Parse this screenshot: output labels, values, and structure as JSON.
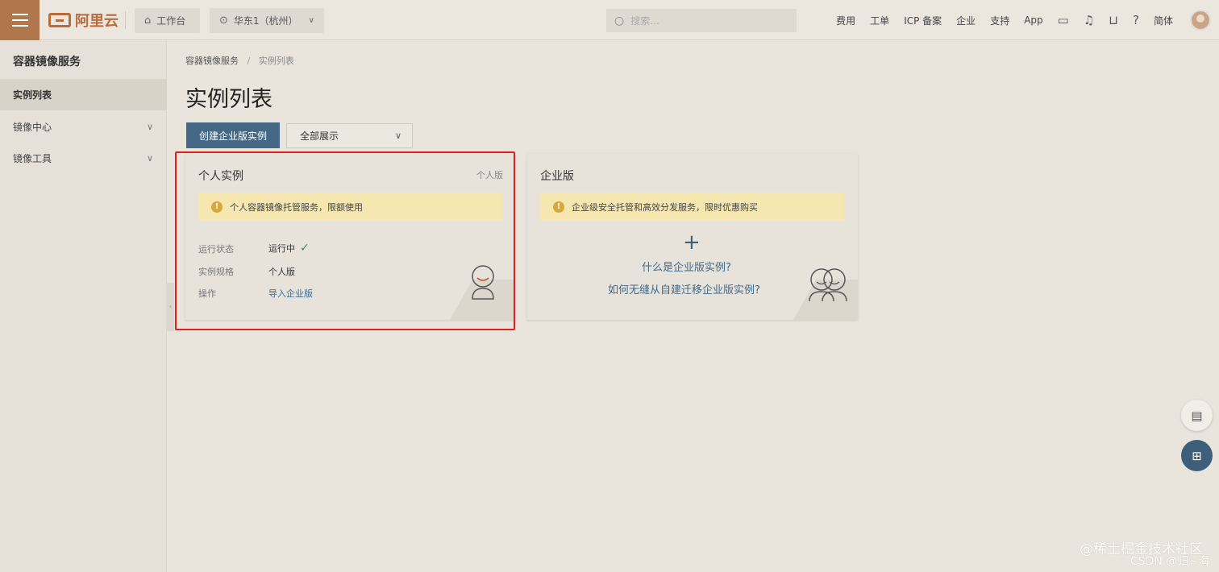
{
  "header": {
    "logo_text": "阿里云",
    "workbench": "工作台",
    "region": "华东1（杭州）",
    "search_placeholder": "搜索...",
    "links": [
      "费用",
      "工单",
      "ICP 备案",
      "企业",
      "支持",
      "App"
    ],
    "lang": "简体"
  },
  "sidebar": {
    "title": "容器镜像服务",
    "items": [
      {
        "label": "实例列表"
      },
      {
        "label": "镜像中心"
      },
      {
        "label": "镜像工具"
      }
    ]
  },
  "breadcrumb": {
    "root": "容器镜像服务",
    "sep": "/",
    "current": "实例列表"
  },
  "page": {
    "title": "实例列表",
    "create_button": "创建企业版实例",
    "filter_value": "全部展示"
  },
  "personal_card": {
    "title": "个人实例",
    "tag": "个人版",
    "notice": "个人容器镜像托管服务，限额使用",
    "status_label": "运行状态",
    "status_value": "运行中",
    "spec_label": "实例规格",
    "spec_value": "个人版",
    "op_label": "操作",
    "op_value": "导入企业版"
  },
  "enterprise_card": {
    "title": "企业版",
    "notice": "企业级安全托管和高效分发服务，限时优惠购买",
    "link1": "什么是企业版实例?",
    "link2": "如何无缝从自建迁移企业版实例?"
  },
  "watermark": {
    "line1": "@稀土掘金技术社区",
    "line2": "CSDN @归~海"
  },
  "colors": {
    "brand": "#b0764c",
    "primary_button": "#436784",
    "notice_bg": "#f6e6b0",
    "highlight_border": "#e02020"
  }
}
